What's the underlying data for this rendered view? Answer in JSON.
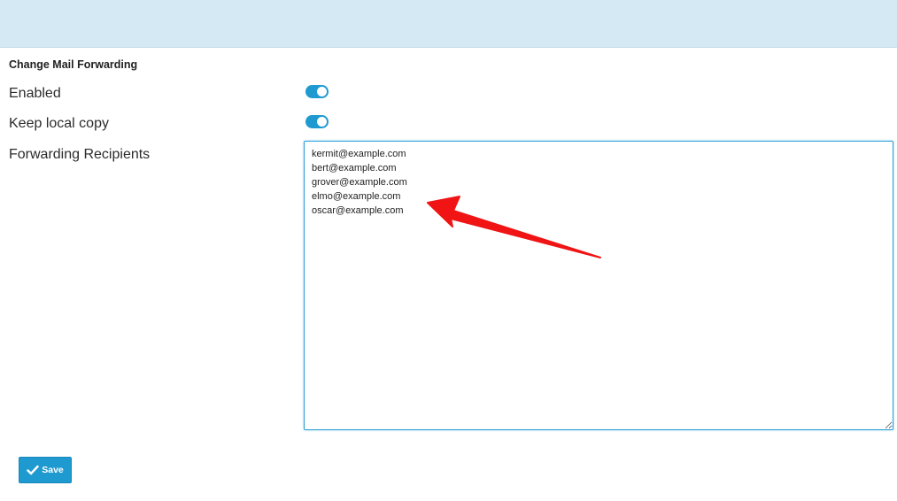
{
  "header": {
    "color": "#d4e9f3"
  },
  "form": {
    "title": "Change Mail Forwarding",
    "enabled": {
      "label": "Enabled",
      "value": true
    },
    "keep_local_copy": {
      "label": "Keep local copy",
      "value": true
    },
    "recipients": {
      "label": "Forwarding Recipients",
      "value": "kermit@example.com\nbert@example.com\ngrover@example.com\nelmo@example.com\noscar@example.com"
    },
    "save_button": {
      "label": "Save",
      "icon": "checkmark-icon"
    }
  },
  "annotation": {
    "type": "red-arrow",
    "color": "#f01414"
  },
  "colors": {
    "accent": "#1f9ad0"
  }
}
